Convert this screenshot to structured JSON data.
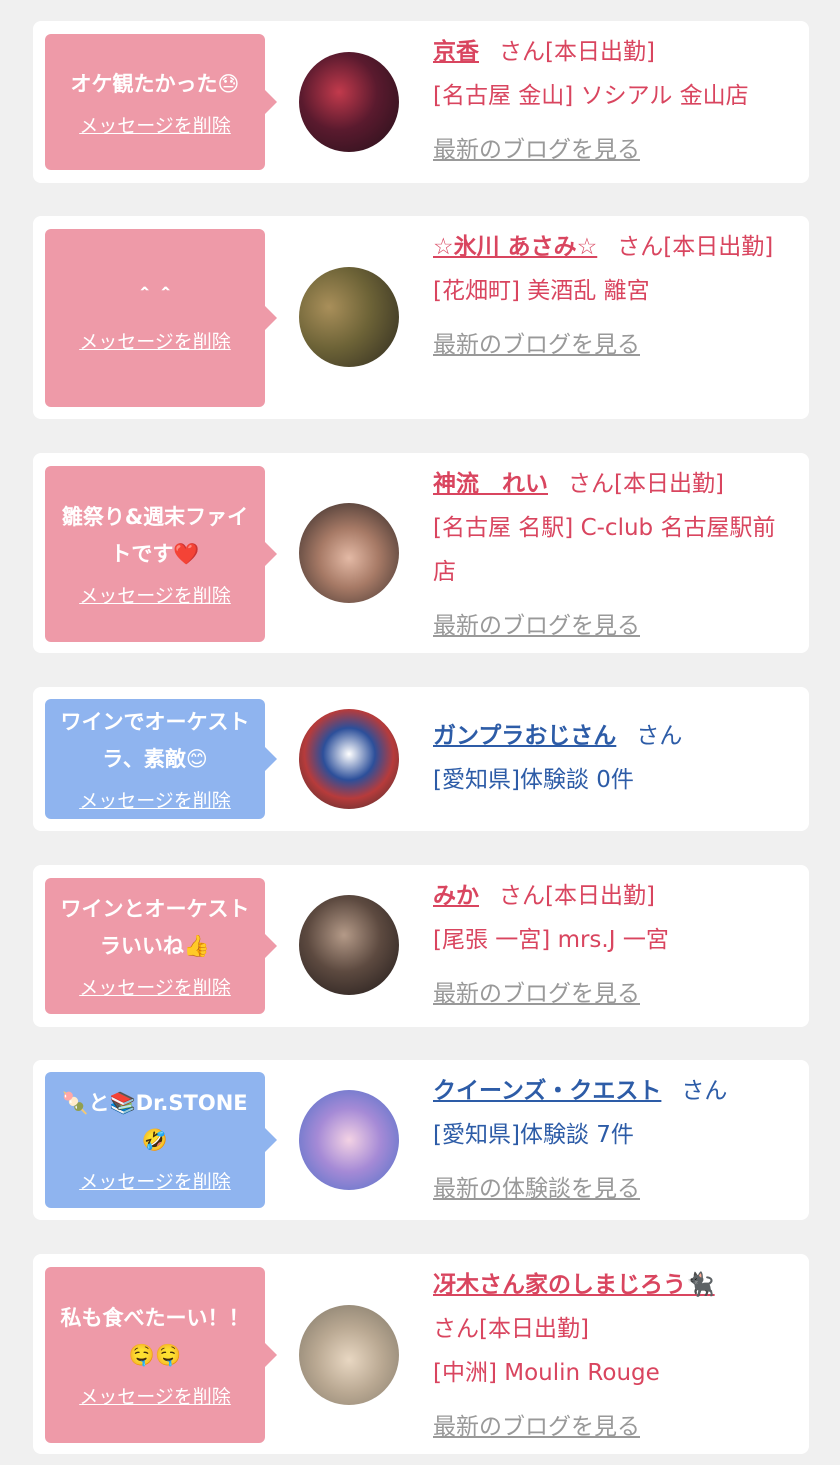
{
  "cards": [
    {
      "message": "オケ観たかった😓",
      "delete_label": "メッセージを削除",
      "name": "京香",
      "suffix": "さん[本日出勤]",
      "shop": "[名古屋 金山] ソシアル 金山店",
      "link": "最新のブログを見る",
      "theme": "pink"
    },
    {
      "message": "＾＾",
      "delete_label": "メッセージを削除",
      "name": "☆氷川 あさみ☆",
      "suffix": "さん[本日出勤]",
      "shop": "[花畑町] 美酒乱 離宮",
      "link": "最新のブログを見る",
      "theme": "pink"
    },
    {
      "message": "雛祭り&週末ファイトです❤️",
      "delete_label": "メッセージを削除",
      "name": "神流　れい",
      "suffix": "さん[本日出勤]",
      "shop": "[名古屋 名駅] C-club 名古屋駅前店",
      "link": "最新のブログを見る",
      "theme": "pink"
    },
    {
      "message": "ワインでオーケストラ、素敵😊",
      "delete_label": "メッセージを削除",
      "name": "ガンプラおじさん",
      "suffix": "さん",
      "shop": "[愛知県]体験談 0件",
      "link": "",
      "theme": "blue"
    },
    {
      "message": "ワインとオーケストラいいね👍",
      "delete_label": "メッセージを削除",
      "name": "みか",
      "suffix": "さん[本日出勤]",
      "shop": "[尾張 一宮] mrs.J 一宮",
      "link": "最新のブログを見る",
      "theme": "pink"
    },
    {
      "message": "🍡と📚Dr.STONE🤣",
      "delete_label": "メッセージを削除",
      "name": "クイーンズ・クエスト",
      "suffix": "さん",
      "shop": "[愛知県]体験談 7件",
      "link": "最新の体験談を見る",
      "theme": "blue"
    },
    {
      "message": "私も食べたーい！！🤤🤤",
      "delete_label": "メッセージを削除",
      "name": "冴木さん家のしまじろう🐈‍⬛",
      "suffix": "さん[本日出勤]",
      "shop": "[中洲] Moulin Rouge",
      "link": "最新のブログを見る",
      "theme": "pink"
    }
  ]
}
